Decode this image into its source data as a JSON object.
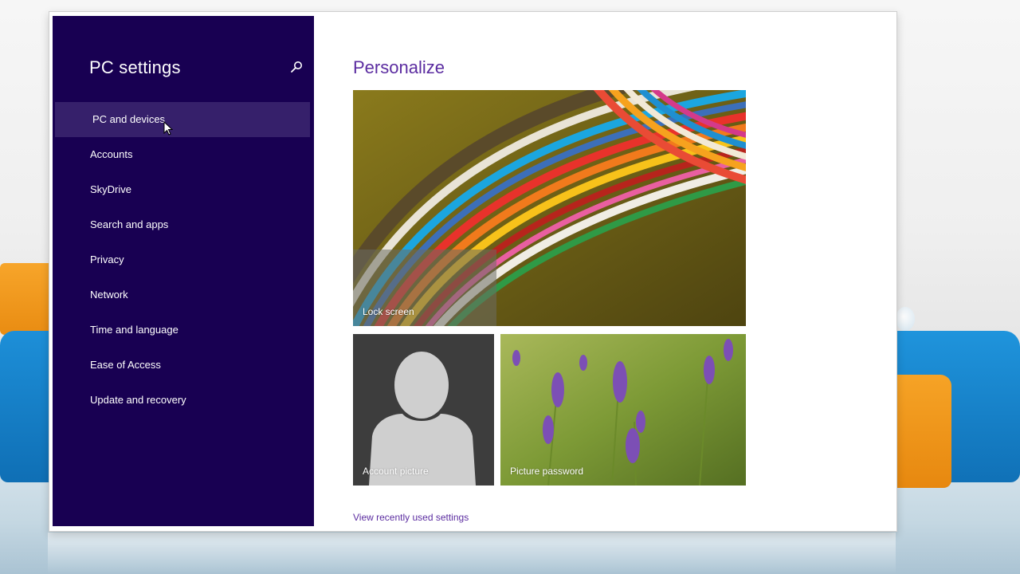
{
  "sidebar": {
    "title": "PC settings",
    "search_icon": "search-icon",
    "items": [
      {
        "label": "PC and devices",
        "selected": true
      },
      {
        "label": "Accounts"
      },
      {
        "label": "SkyDrive"
      },
      {
        "label": "Search and apps"
      },
      {
        "label": "Privacy"
      },
      {
        "label": "Network"
      },
      {
        "label": "Time and language"
      },
      {
        "label": "Ease of Access"
      },
      {
        "label": "Update and recovery"
      }
    ]
  },
  "main": {
    "title": "Personalize",
    "tiles": {
      "lock_screen": "Lock screen",
      "account_picture": "Account picture",
      "picture_password": "Picture password"
    },
    "link": "View recently used settings"
  },
  "colors": {
    "sidebar_bg": "#180052",
    "selected_bg": "#36206b",
    "accent": "#5b2ca0"
  }
}
